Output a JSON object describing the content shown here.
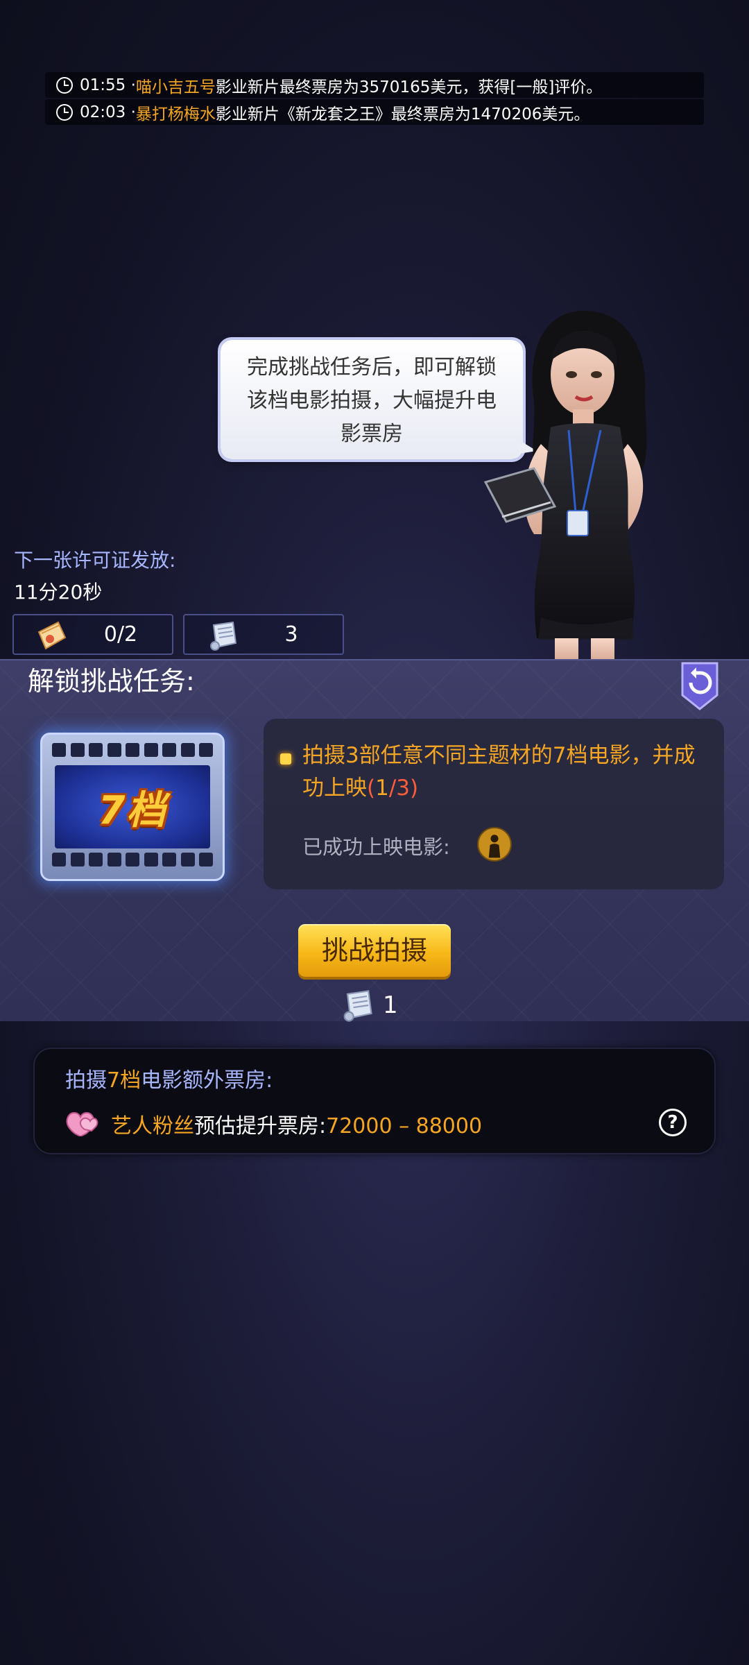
{
  "ticker": [
    {
      "time": "01:55 · ",
      "name": "喵小吉五号",
      "text": "影业新片最终票房为3570165美元，获得[一般]评价。"
    },
    {
      "time": "02:03 · ",
      "name": "暴打杨梅水",
      "text": "影业新片《新龙套之王》最终票房为1470206美元。"
    }
  ],
  "bubble": {
    "text": "完成挑战任务后，即可解锁该档电影拍摄，大幅提升电影票房"
  },
  "license": {
    "label": "下一张许可证发放:",
    "time": "11分20秒",
    "permits": "0/2",
    "scrolls": "3"
  },
  "challenge": {
    "title": "解锁挑战任务:",
    "tier_label": "7档",
    "task": "拍摄3部任意不同主题材的7档电影，并成功上映",
    "progress_open": "(",
    "progress_current": "1",
    "progress_sep": "/3)",
    "done_label": "已成功上映电影:",
    "button": "挑战拍摄",
    "cost": "1"
  },
  "bonus": {
    "title_prefix": "拍摄",
    "title_tier": "7档",
    "title_suffix": "电影额外票房:",
    "source": "艺人粉丝",
    "estimate_label": "预估提升票房:",
    "range": "72000 – 88000"
  },
  "colors": {
    "accent": "#f6a623",
    "label_blue": "#a8b6ff",
    "button_gold": "#f7b818"
  },
  "icons": [
    "clock-icon",
    "permit-ticket-icon",
    "scroll-icon",
    "back-icon",
    "heart-icon",
    "help-icon"
  ]
}
